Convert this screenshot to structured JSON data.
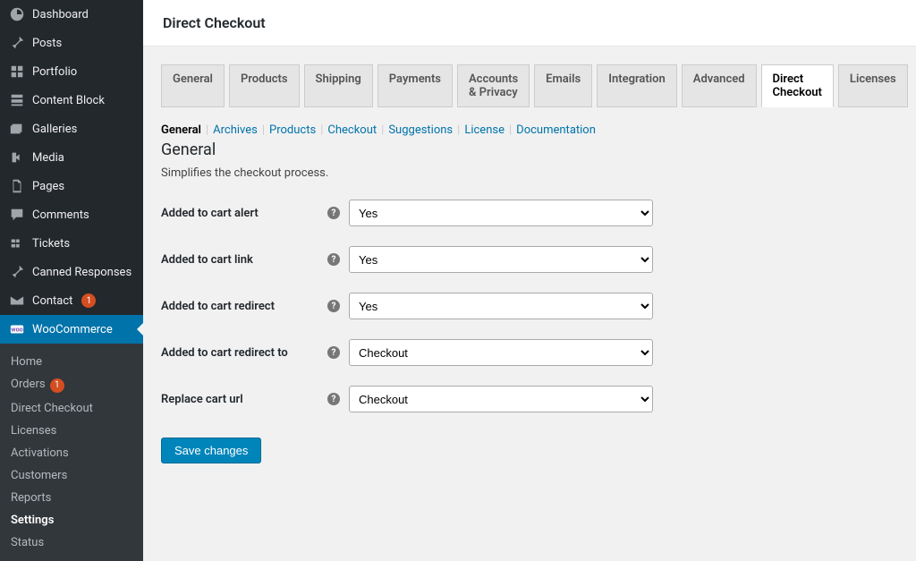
{
  "page_title": "Direct Checkout",
  "sidebar": {
    "items": [
      {
        "id": "dashboard",
        "label": "Dashboard",
        "icon": "dashboard-icon"
      },
      {
        "id": "posts",
        "label": "Posts",
        "icon": "pin-icon"
      },
      {
        "id": "portfolio",
        "label": "Portfolio",
        "icon": "grid-icon"
      },
      {
        "id": "content-block",
        "label": "Content Block",
        "icon": "block-icon"
      },
      {
        "id": "galleries",
        "label": "Galleries",
        "icon": "images-icon"
      },
      {
        "id": "media",
        "label": "Media",
        "icon": "media-icon"
      },
      {
        "id": "pages",
        "label": "Pages",
        "icon": "pages-icon"
      },
      {
        "id": "comments",
        "label": "Comments",
        "icon": "comment-icon"
      },
      {
        "id": "tickets",
        "label": "Tickets",
        "icon": "ticket-icon"
      },
      {
        "id": "canned",
        "label": "Canned Responses",
        "icon": "pin-icon"
      },
      {
        "id": "contact",
        "label": "Contact",
        "icon": "mail-icon",
        "badge": "1"
      },
      {
        "id": "woocommerce",
        "label": "WooCommerce",
        "icon": "woo-icon",
        "active": true
      }
    ],
    "sub_items": [
      {
        "label": "Home"
      },
      {
        "label": "Orders",
        "badge": "1"
      },
      {
        "label": "Direct Checkout"
      },
      {
        "label": "Licenses"
      },
      {
        "label": "Activations"
      },
      {
        "label": "Customers"
      },
      {
        "label": "Reports"
      },
      {
        "label": "Settings",
        "active": true
      },
      {
        "label": "Status"
      }
    ]
  },
  "tabs": [
    "General",
    "Products",
    "Shipping",
    "Payments",
    "Accounts & Privacy",
    "Emails",
    "Integration",
    "Advanced",
    "Direct Checkout",
    "Licenses"
  ],
  "active_tab": "Direct Checkout",
  "subnav": [
    {
      "label": "General",
      "current": true
    },
    {
      "label": "Archives"
    },
    {
      "label": "Products"
    },
    {
      "label": "Checkout"
    },
    {
      "label": "Suggestions"
    },
    {
      "label": "License"
    },
    {
      "label": "Documentation"
    }
  ],
  "section": {
    "title": "General",
    "description": "Simplifies the checkout process."
  },
  "form": {
    "rows": [
      {
        "label": "Added to cart alert",
        "value": "Yes"
      },
      {
        "label": "Added to cart link",
        "value": "Yes"
      },
      {
        "label": "Added to cart redirect",
        "value": "Yes"
      },
      {
        "label": "Added to cart redirect to",
        "value": "Checkout"
      },
      {
        "label": "Replace cart url",
        "value": "Checkout"
      }
    ],
    "save_button": "Save changes"
  }
}
